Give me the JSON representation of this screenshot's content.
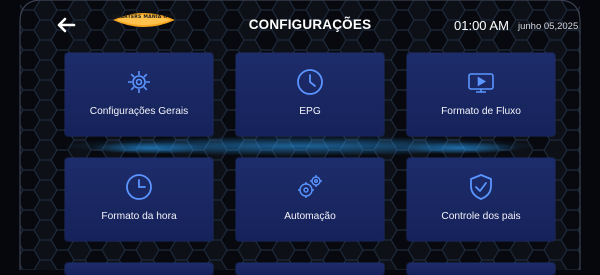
{
  "header": {
    "title": "CONFIGURAÇÕES",
    "time": "01:00 AM",
    "date": "junho 05,2025",
    "logo_text": "SMARTERS MANIA IPTV"
  },
  "tiles": [
    {
      "label": "Configurações Gerais",
      "icon": "gears-icon"
    },
    {
      "label": "EPG",
      "icon": "clock-icon"
    },
    {
      "label": "Formato de Fluxo",
      "icon": "stream-format-icon"
    },
    {
      "label": "Formato da hora",
      "icon": "time-format-icon"
    },
    {
      "label": "Automação",
      "icon": "automation-icon"
    },
    {
      "label": "Controle dos pais",
      "icon": "parental-shield-icon"
    }
  ],
  "colors": {
    "tile": "#1b2a68",
    "icon": "#5b95ff",
    "accent_glow": "#1f8fff",
    "logo": "#f5a623"
  }
}
